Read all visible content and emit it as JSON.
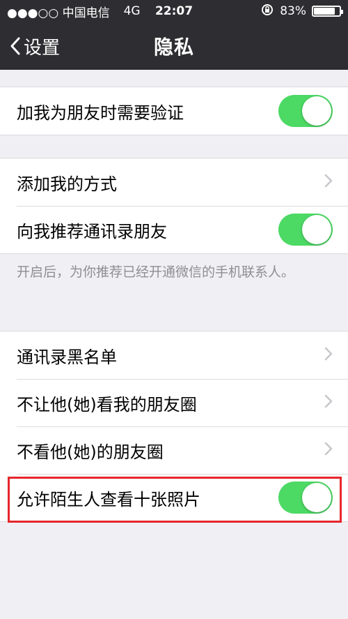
{
  "status_bar": {
    "carrier": "●●●○○ 中国电信",
    "network": "4G",
    "time": "22:07",
    "battery_percent": "83%",
    "battery_level": 0.83
  },
  "nav": {
    "back_label": "设置",
    "title": "隐私"
  },
  "group1": {
    "row_verify": {
      "label": "加我为朋友时需要验证",
      "toggle_on": true
    }
  },
  "group2": {
    "row_add_methods": {
      "label": "添加我的方式"
    },
    "row_recommend": {
      "label": "向我推荐通讯录朋友",
      "toggle_on": true
    },
    "note": "开启后，为你推荐已经开通微信的手机联系人。"
  },
  "group3": {
    "row_blacklist": {
      "label": "通讯录黑名单"
    },
    "row_hide_moments": {
      "label": "不让他(她)看我的朋友圈"
    },
    "row_not_view": {
      "label": "不看他(她)的朋友圈"
    },
    "row_strangers": {
      "label": "允许陌生人查看十张照片",
      "toggle_on": true
    }
  },
  "colors": {
    "nav_bg": "#2e2e32",
    "toggle_on": "#4cd964",
    "highlight": "#e5262c",
    "page_bg": "#efeff4"
  }
}
